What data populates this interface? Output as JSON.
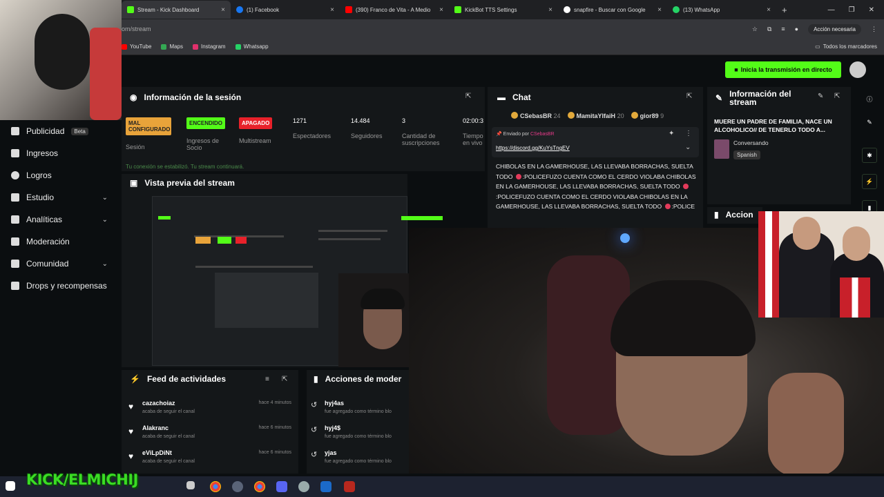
{
  "browser": {
    "tabs": [
      {
        "label": "Stream - Kick Dashboard",
        "color": "#53fc18",
        "active": true
      },
      {
        "label": "(1) Facebook",
        "color": "#1877f2"
      },
      {
        "label": "(390) Franco de Vita - A Medio",
        "color": "#ff0000"
      },
      {
        "label": "KickBot TTS Settings",
        "color": "#53fc18"
      },
      {
        "label": "snapfire - Buscar con Google",
        "color": "#ffffff"
      },
      {
        "label": "(13) WhatsApp",
        "color": "#25d366"
      }
    ],
    "new_tab": "+",
    "url": "om/stream",
    "accion_label": "Acción necesaria",
    "bookmarks": [
      "YouTube",
      "Maps",
      "Instagram",
      "Whatsapp"
    ],
    "bookmarks_right": "Todos los marcadores"
  },
  "topbar": {
    "golive_label": "Inicia la transmisión en directo"
  },
  "sidebar": {
    "items": [
      {
        "label": "Publicidad",
        "badge": "Beta"
      },
      {
        "label": "Ingresos"
      },
      {
        "label": "Logros"
      },
      {
        "label": "Estudio",
        "chevron": "⌄"
      },
      {
        "label": "Analíticas",
        "chevron": "⌄"
      },
      {
        "label": "Moderación"
      },
      {
        "label": "Comunidad",
        "chevron": "⌄"
      },
      {
        "label": "Drops y recompensas"
      }
    ]
  },
  "session": {
    "title": "Información de la sesión",
    "stats": [
      {
        "value": "MAL CONFIGURADO",
        "label": "Sesión",
        "color": "#e8a33a"
      },
      {
        "value": "ENCENDIDO",
        "label": "Ingresos de Socio",
        "color": "#53fc18"
      },
      {
        "value": "APAGADO",
        "label": "Multistream",
        "color": "#e8212a"
      },
      {
        "value": "1271",
        "label": "Espectadores"
      },
      {
        "value": "14.484",
        "label": "Seguidores"
      },
      {
        "value": "3",
        "label": "Cantidad de suscripciones"
      },
      {
        "value": "02:00:3",
        "label": "Tiempo en vivo"
      }
    ],
    "connection": "Tu conexión se estabilizó. Tu stream continuará."
  },
  "preview": {
    "title": "Vista previa del stream"
  },
  "feed": {
    "title": "Feed de actividades",
    "items": [
      {
        "name": "cazachoiaz",
        "sub": "acaba de seguir el canal",
        "time": "hace 4 minutos"
      },
      {
        "name": "Alakranc",
        "sub": "acaba de seguir el canal",
        "time": "hace 6 minutos"
      },
      {
        "name": "eViLpDiNt",
        "sub": "acaba de seguir el canal",
        "time": "hace 6 minutos"
      }
    ]
  },
  "mod_actions": {
    "title": "Acciones de moder",
    "items": [
      {
        "name": "hyj4as",
        "sub": "fue agregado como término blo"
      },
      {
        "name": "hyj4$",
        "sub": "fue agregado como término blo"
      },
      {
        "name": "yjas",
        "sub": "fue agregado como término blo"
      }
    ]
  },
  "chat": {
    "title": "Chat",
    "gifters": [
      {
        "name": "CSebasBR",
        "count": "24"
      },
      {
        "name": "MamitaYIfaiH",
        "count": "20"
      },
      {
        "name": "gior89",
        "count": "9"
      }
    ],
    "pinned_by": "Enviado por",
    "pinned_user": "CSebasBR",
    "pinned_link": "https://discord.gg/KuYsTngEV",
    "message_1": "CHIBOLAS EN LA GAMERHOUSE, LAS LLEVABA BORRACHAS, SUELTA TODO",
    "message_2": ":POLICEFUZO CUENTA COMO EL CERDO VIOLABA CHIBOLAS EN LA GAMERHOUSE, LAS LLEVABA BORRACHAS, SUELTA TODO",
    "message_3": ":POLICEFUZO CUENTA COMO EL CERDO VIOLABA CHIBOLAS EN LA GAMERHOUSE, LAS LLEVABA BORRACHAS, SUELTA TODO",
    "message_4": ":POLICE"
  },
  "stream_info": {
    "title": "Información del stream",
    "stream_title": "MUERE UN PADRE DE FAMILIA, NACE UN ALCOHOLICO// DE TENERLO TODO A...",
    "category": "Conversando",
    "language": "Spanish"
  },
  "mod_actions_2": {
    "title": "Accion"
  },
  "overlay": {
    "logo_text": "KICK/ELMICHIJ"
  }
}
